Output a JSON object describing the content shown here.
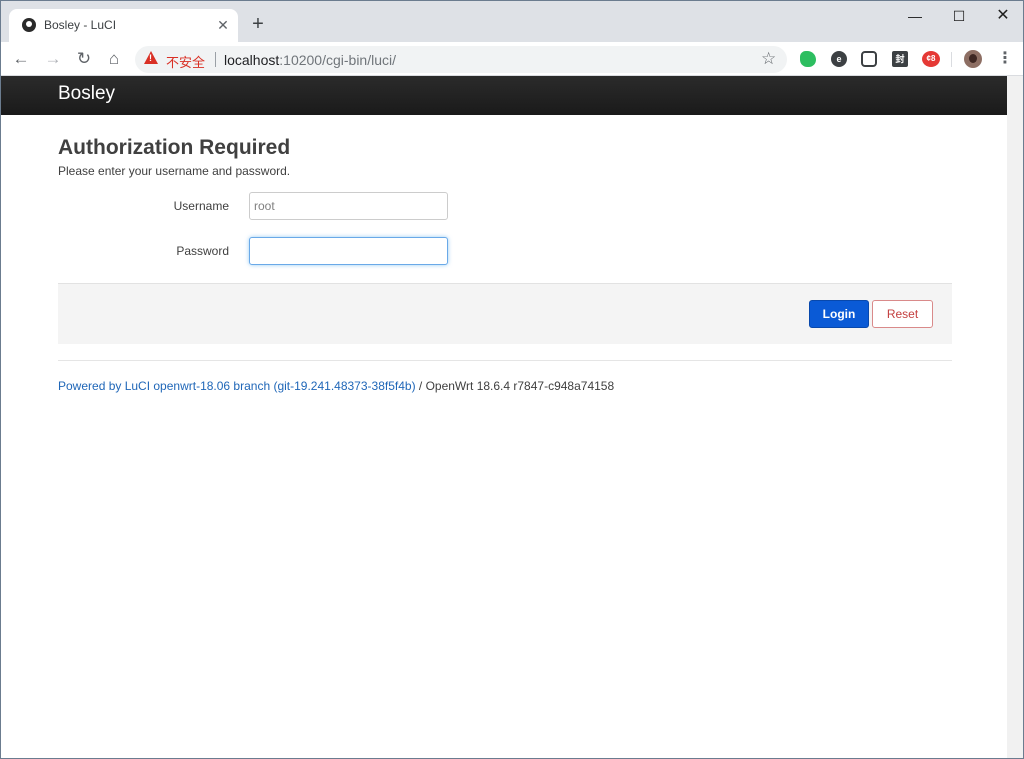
{
  "browser": {
    "tab": {
      "title": "Bosley - LuCI",
      "close": "✕"
    },
    "new_tab": "+",
    "window_controls": {
      "minimize": "—",
      "maximize": "☐",
      "close": "✕"
    },
    "nav": {
      "back": "←",
      "forward": "→",
      "reload": "↻",
      "home": "⌂"
    },
    "omnibox": {
      "security_label": "不安全",
      "url_host": "localhost",
      "url_rest": ":10200/cgi-bin/luci/"
    },
    "bookmark_star": "☆",
    "extensions": [
      {
        "name": "evernote-icon",
        "glyph": ""
      },
      {
        "name": "e-extension-icon",
        "glyph": "e"
      },
      {
        "name": "chat-extension-icon",
        "glyph": ""
      },
      {
        "name": "seal-extension-icon",
        "glyph": "封"
      },
      {
        "name": "red-extension-icon",
        "glyph": "¢8"
      }
    ],
    "menu": "⋮"
  },
  "luci": {
    "brand": "Bosley",
    "title": "Authorization Required",
    "description": "Please enter your username and password.",
    "username": {
      "label": "Username",
      "placeholder": "root",
      "value": ""
    },
    "password": {
      "label": "Password",
      "value": ""
    },
    "login_label": "Login",
    "reset_label": "Reset",
    "footer": {
      "link_text": "Powered by LuCI openwrt-18.06 branch (git-19.241.48373-38f5f4b)",
      "rest_text": " / OpenWrt 18.6.4 r7847-c948a74158"
    }
  },
  "colors": {
    "header_bg": "#222222",
    "login_bg": "#0a5ad6",
    "reset_text": "#c44040",
    "link": "#2067b8",
    "insecure": "#d93025"
  }
}
